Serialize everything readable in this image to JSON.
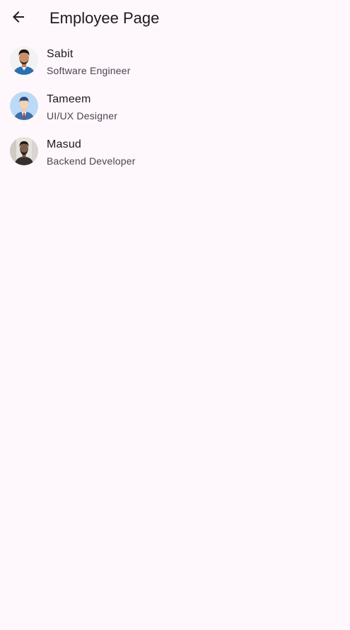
{
  "app_bar": {
    "back_icon": "arrow-back-icon",
    "title": "Employee Page"
  },
  "employees": [
    {
      "name": "Sabit",
      "role": "Software Engineer",
      "avatar_icon": "avatar-photo-sabit"
    },
    {
      "name": "Tameem",
      "role": "UI/UX Designer",
      "avatar_icon": "avatar-illustration-tameem"
    },
    {
      "name": "Masud",
      "role": "Backend Developer",
      "avatar_icon": "avatar-photo-masud"
    }
  ],
  "colors": {
    "background": "#fef7fc",
    "title_text": "#1d1b20",
    "subtitle_text": "#49454f"
  }
}
